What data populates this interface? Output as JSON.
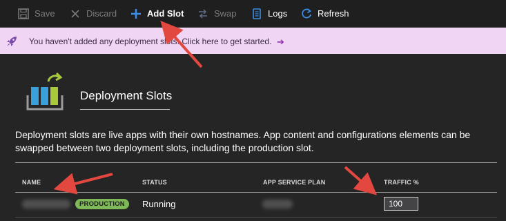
{
  "toolbar": {
    "save_label": "Save",
    "discard_label": "Discard",
    "add_slot_label": "Add Slot",
    "swap_label": "Swap",
    "logs_label": "Logs",
    "refresh_label": "Refresh"
  },
  "banner": {
    "message": "You haven't added any deployment slots. Click here to get started.",
    "arrow": "➔"
  },
  "main": {
    "title": "Deployment Slots",
    "description": "Deployment slots are live apps with their own hostnames. App content and configurations elements can be swapped between two deployment slots, including the production slot."
  },
  "table": {
    "columns": [
      "NAME",
      "STATUS",
      "APP SERVICE PLAN",
      "TRAFFIC %"
    ],
    "rows": [
      {
        "badge": "PRODUCTION",
        "status": "Running",
        "traffic": "100"
      }
    ]
  },
  "colors": {
    "background": "#252526",
    "toolbar": "#1f1f20",
    "banner": "#f1d5f5",
    "accent_blue": "#3a8ee6",
    "badge_green": "#7fb957",
    "arrow_red": "#e2483f"
  },
  "icons": {
    "save": "save-icon",
    "discard": "close-icon",
    "add_slot": "plus-icon",
    "swap": "swap-icon",
    "logs": "document-icon",
    "refresh": "refresh-icon",
    "banner": "rocket-icon",
    "hero": "deployment-slots-icon"
  }
}
